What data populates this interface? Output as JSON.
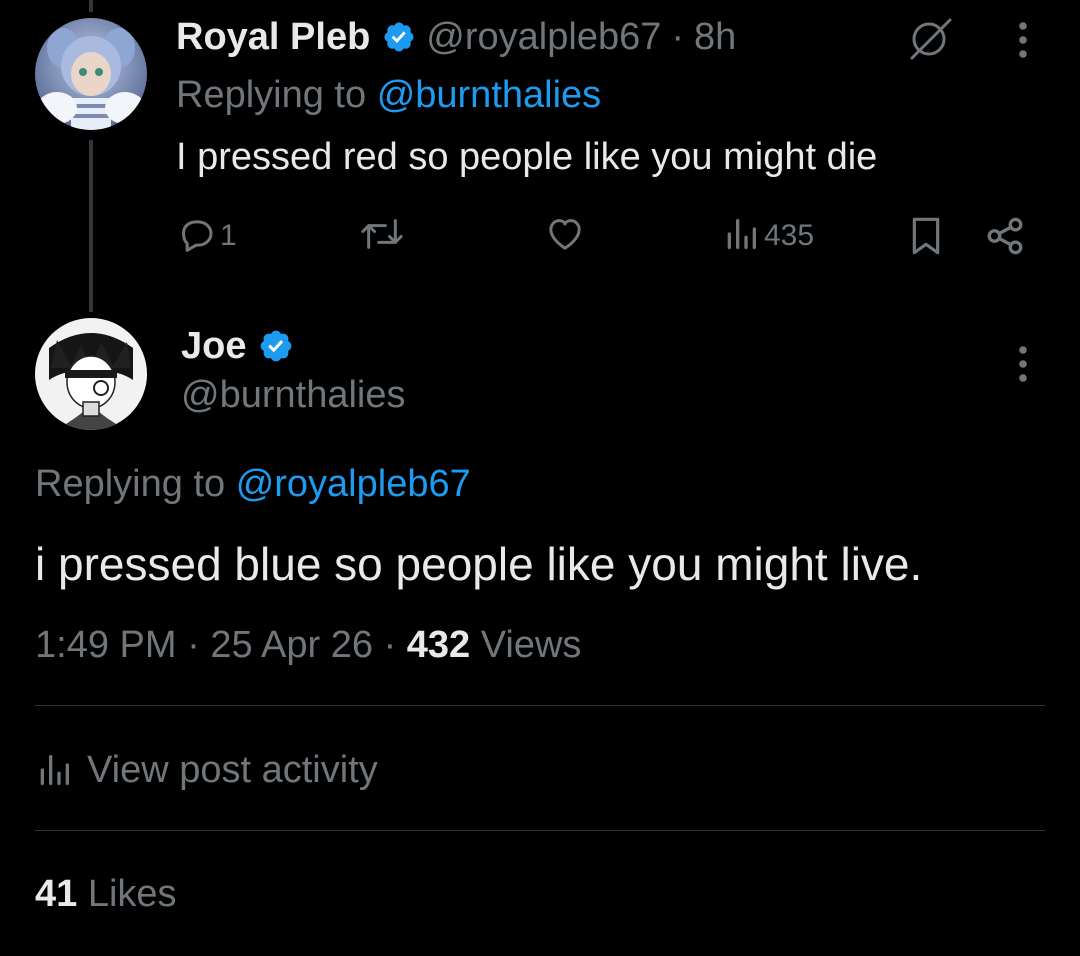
{
  "reply_tweet": {
    "display_name": "Royal Pleb",
    "handle": "@royalpleb67",
    "separator": "·",
    "time_ago": "8h",
    "replying_prefix": "Replying to",
    "replying_to": "@burnthalies",
    "text": "I pressed red so people like you might die",
    "actions": {
      "replies": "1",
      "retweets": "",
      "likes": "",
      "views": "435"
    }
  },
  "main_tweet": {
    "display_name": "Joe",
    "handle": "@burnthalies",
    "replying_prefix": "Replying to",
    "replying_to": "@royalpleb67",
    "text": "i pressed blue so people like you might live.",
    "time": "1:49 PM",
    "separator": "·",
    "date": "25 Apr 26",
    "views_count": "432",
    "views_label": "Views",
    "activity_label": "View post activity",
    "likes_count": "41",
    "likes_label": "Likes"
  },
  "colors": {
    "background": "#000000",
    "text": "#e7e9ea",
    "muted": "#71767b",
    "accent": "#1d9bf0",
    "divider": "#2f3336"
  },
  "icons": [
    "verified-badge-icon",
    "grok-slash-icon",
    "more-icon",
    "reply-icon",
    "retweet-icon",
    "like-icon",
    "views-icon",
    "bookmark-icon",
    "share-icon",
    "activity-icon"
  ]
}
